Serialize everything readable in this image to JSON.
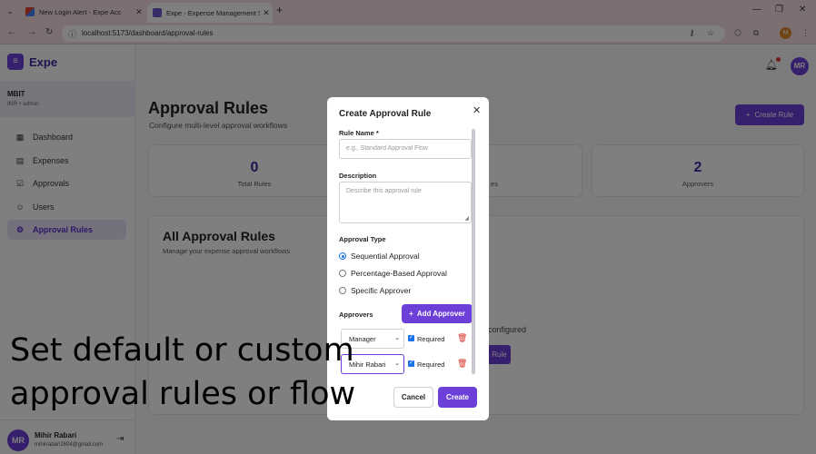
{
  "browser": {
    "tabs": [
      {
        "title": "New Login Alert - Expe Acc",
        "icon": "gmail-icon"
      },
      {
        "title": "Expe - Expense Management Sy",
        "icon": "expe-icon"
      }
    ],
    "url": "localhost:5173/dashboard/approval-rules",
    "profile_initial": "M"
  },
  "app": {
    "brand": "Expe",
    "company": {
      "name": "MBIT",
      "sub": "INR • admin"
    },
    "nav": [
      {
        "label": "Dashboard",
        "icon": "grid-icon",
        "active": false
      },
      {
        "label": "Expenses",
        "icon": "receipt-icon",
        "active": false
      },
      {
        "label": "Approvals",
        "icon": "check-square-icon",
        "active": false
      },
      {
        "label": "Users",
        "icon": "users-icon",
        "active": false
      },
      {
        "label": "Approval Rules",
        "icon": "gear-icon",
        "active": true
      }
    ],
    "user": {
      "initials": "MR",
      "name": "Mihir Rabari",
      "email": "mihirrabari2604@gmail.com"
    },
    "header": {
      "avatar": "MR"
    }
  },
  "page": {
    "title": "Approval Rules",
    "subtitle": "Configure multi-level approval workflows",
    "create_button": "Create Rule",
    "stats": [
      {
        "value": "0",
        "label": "Total Rules"
      },
      {
        "value": "",
        "label": "es"
      },
      {
        "value": "2",
        "label": "Approvers"
      }
    ],
    "panel": {
      "title": "All Approval Rules",
      "subtitle": "Manage your expense approval workflows",
      "empty_text": "configured",
      "empty_button": "Rule"
    }
  },
  "modal": {
    "title": "Create Approval Rule",
    "rule_name_label": "Rule Name *",
    "rule_name_placeholder": "e.g., Standard Approval Flow",
    "description_label": "Description",
    "description_placeholder": "Describe this approval rule",
    "approval_type_label": "Approval Type",
    "approval_types": [
      {
        "label": "Sequential Approval",
        "selected": true
      },
      {
        "label": "Percentage-Based Approval",
        "selected": false
      },
      {
        "label": "Specific Approver",
        "selected": false
      }
    ],
    "approvers_label": "Approvers",
    "add_approver": "Add Approver",
    "approvers": [
      {
        "value": "Manager",
        "required_label": "Required",
        "required": true
      },
      {
        "value": "Mihir Rabari",
        "required_label": "Required",
        "required": true
      }
    ],
    "cancel": "Cancel",
    "create": "Create"
  },
  "caption": {
    "line1": "Set default or custom",
    "line2": "approval rules or flow"
  },
  "colors": {
    "accent": "#6d3fd9",
    "brand_text": "#3b2a9e",
    "danger": "#d93025"
  }
}
